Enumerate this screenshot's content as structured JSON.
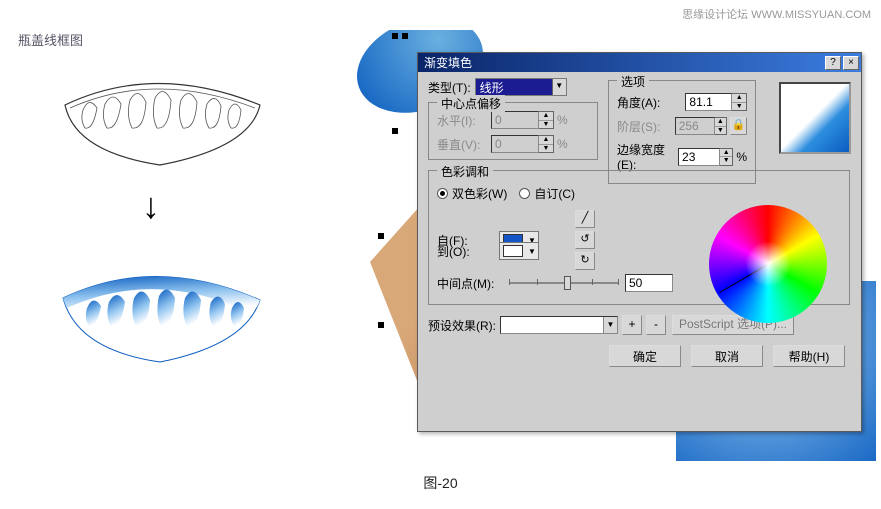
{
  "watermark": "思缘设计论坛  WWW.MISSYUAN.COM",
  "left_label": "瓶盖线框图",
  "figure_caption": "图-20",
  "dialog": {
    "title": "渐变填色",
    "type_label": "类型(T):",
    "type_value": "线形",
    "offset": {
      "legend": "中心点偏移",
      "h_label": "水平(I):",
      "h_value": "0",
      "v_label": "垂直(V):",
      "v_value": "0"
    },
    "options": {
      "legend": "选项",
      "angle_label": "角度(A):",
      "angle_value": "81.1",
      "step_label": "阶层(S):",
      "step_value": "256",
      "edge_label": "边缘宽度(E):",
      "edge_value": "23"
    },
    "harmony": {
      "legend": "色彩调和",
      "two_label": "双色彩(W)",
      "custom_label": "自订(C)",
      "from_label": "自(F):",
      "to_label": "到(O):",
      "from_color": "#1555c7",
      "to_color": "#ffffff",
      "mid_label": "中间点(M):",
      "mid_value": "50",
      "tool_line": "╱",
      "tool_ccw": "↺",
      "tool_cw": "↻"
    },
    "preset_label": "预设效果(R):",
    "ps_button": "PostScript 选项(P)...",
    "ok": "确定",
    "cancel": "取消",
    "help": "帮助(H)",
    "pct": "%",
    "plus": "+",
    "minus": "-"
  }
}
